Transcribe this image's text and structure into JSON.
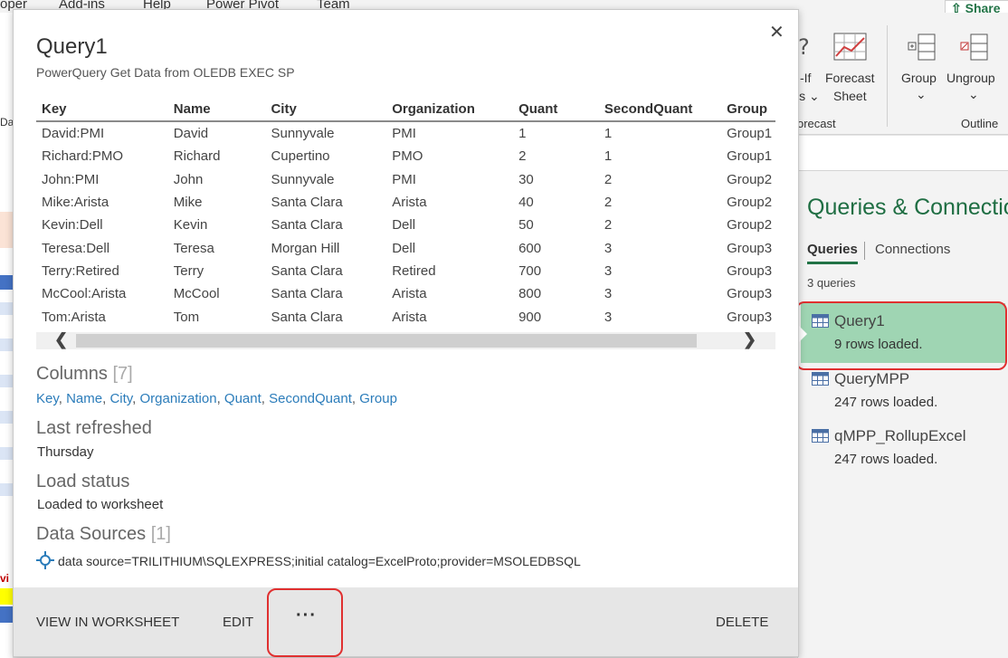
{
  "menubar": [
    "oper",
    "Add-ins",
    "Help",
    "Power Pivot",
    "Team"
  ],
  "share_label": "Share",
  "ribbon": {
    "whatif_line1": "-If",
    "whatif_line2": "is",
    "forecast_line1": "Forecast",
    "forecast_line2": "Sheet",
    "forecast_group": "orecast",
    "group_label": "Group",
    "ungroup_label": "Ungroup",
    "outline_group": "Outline"
  },
  "grid_fragments": {
    "da": "Da",
    "vi": "vi"
  },
  "popup": {
    "title": "Query1",
    "subtitle": "PowerQuery Get Data from OLEDB EXEC SP",
    "columns": [
      "Key",
      "Name",
      "City",
      "Organization",
      "Quant",
      "SecondQuant",
      "Group"
    ],
    "rows": [
      [
        "David:PMI",
        "David",
        "Sunnyvale",
        "PMI",
        "1",
        "1",
        "Group1"
      ],
      [
        "Richard:PMO",
        "Richard",
        "Cupertino",
        "PMO",
        "2",
        "1",
        "Group1"
      ],
      [
        "John:PMI",
        "John",
        "Sunnyvale",
        "PMI",
        "30",
        "2",
        "Group2"
      ],
      [
        "Mike:Arista",
        "Mike",
        "Santa Clara",
        "Arista",
        "40",
        "2",
        "Group2"
      ],
      [
        "Kevin:Dell",
        "Kevin",
        "Santa Clara",
        "Dell",
        "50",
        "2",
        "Group2"
      ],
      [
        "Teresa:Dell",
        "Teresa",
        "Morgan Hill",
        "Dell",
        "600",
        "3",
        "Group3"
      ],
      [
        "Terry:Retired",
        "Terry",
        "Santa Clara",
        "Retired",
        "700",
        "3",
        "Group3"
      ],
      [
        "McCool:Arista",
        "McCool",
        "Santa Clara",
        "Arista",
        "800",
        "3",
        "Group3"
      ],
      [
        "Tom:Arista",
        "Tom",
        "Santa Clara",
        "Arista",
        "900",
        "3",
        "Group3"
      ]
    ],
    "columns_heading": "Columns",
    "columns_count": "[7]",
    "column_links": [
      "Key",
      "Name",
      "City",
      "Organization",
      "Quant",
      "SecondQuant",
      "Group"
    ],
    "last_refreshed_heading": "Last refreshed",
    "last_refreshed_value": "Thursday",
    "load_status_heading": "Load status",
    "load_status_value": "Loaded to worksheet",
    "data_sources_heading": "Data Sources",
    "data_sources_count": "[1]",
    "data_source": "data source=TRILITHIUM\\SQLEXPRESS;initial catalog=ExcelProto;provider=MSOLEDBSQL",
    "footer": {
      "view": "VIEW IN WORKSHEET",
      "edit": "EDIT",
      "more": "···",
      "delete": "DELETE"
    }
  },
  "pane": {
    "title": "Queries & Connections",
    "tab_queries": "Queries",
    "tab_connections": "Connections",
    "count": "3 queries",
    "items": [
      {
        "name": "Query1",
        "rows": "9 rows loaded."
      },
      {
        "name": "QueryMPP",
        "rows": "247 rows loaded."
      },
      {
        "name": "qMPP_RollupExcel",
        "rows": "247 rows loaded."
      }
    ]
  },
  "colors": {
    "accent": "#217346",
    "selected": "#9fd5b3",
    "link": "#2b7cba",
    "highlight": "#e03030"
  },
  "icons": [
    "close-icon",
    "scroll-left-icon",
    "scroll-right-icon",
    "data-source-icon",
    "table-icon",
    "forecast-sheet-icon",
    "group-icon",
    "ungroup-icon",
    "share-icon"
  ]
}
